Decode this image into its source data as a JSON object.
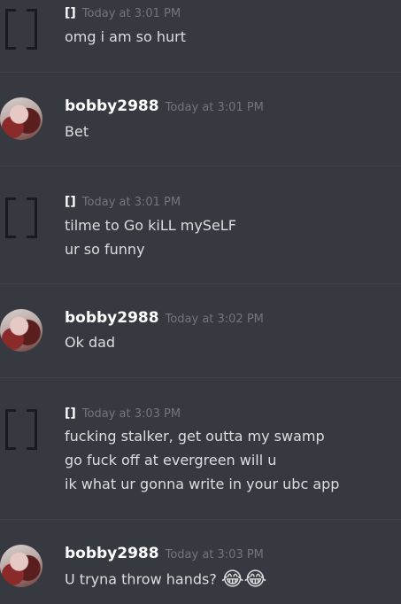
{
  "messages": [
    {
      "user": "[]",
      "time": "Today at 3:01 PM",
      "lines": [
        "omg i am so hurt"
      ]
    },
    {
      "user": "bobby2988",
      "time": "Today at 3:01 PM",
      "lines": [
        "Bet"
      ]
    },
    {
      "user": "[]",
      "time": "Today at 3:01 PM",
      "lines": [
        "tilme to Go kiLL mySeLF",
        "ur so funny"
      ]
    },
    {
      "user": "bobby2988",
      "time": "Today at 3:02 PM",
      "lines": [
        "Ok dad"
      ]
    },
    {
      "user": "[]",
      "time": "Today at 3:03 PM",
      "lines": [
        "fucking stalker, get outta my swamp",
        "go fuck off at evergreen will u",
        "ik what ur gonna write in your ubc app"
      ]
    },
    {
      "user": "bobby2988",
      "time": "Today at 3:03 PM",
      "lines": [
        "U tryna throw hands?"
      ],
      "emoji": "😂😂"
    }
  ],
  "icons": {
    "bracket_avatar": "bracket-avatar-icon",
    "photo_avatar": "user-photo-avatar",
    "emoji": "tears-of-joy-emoji"
  }
}
